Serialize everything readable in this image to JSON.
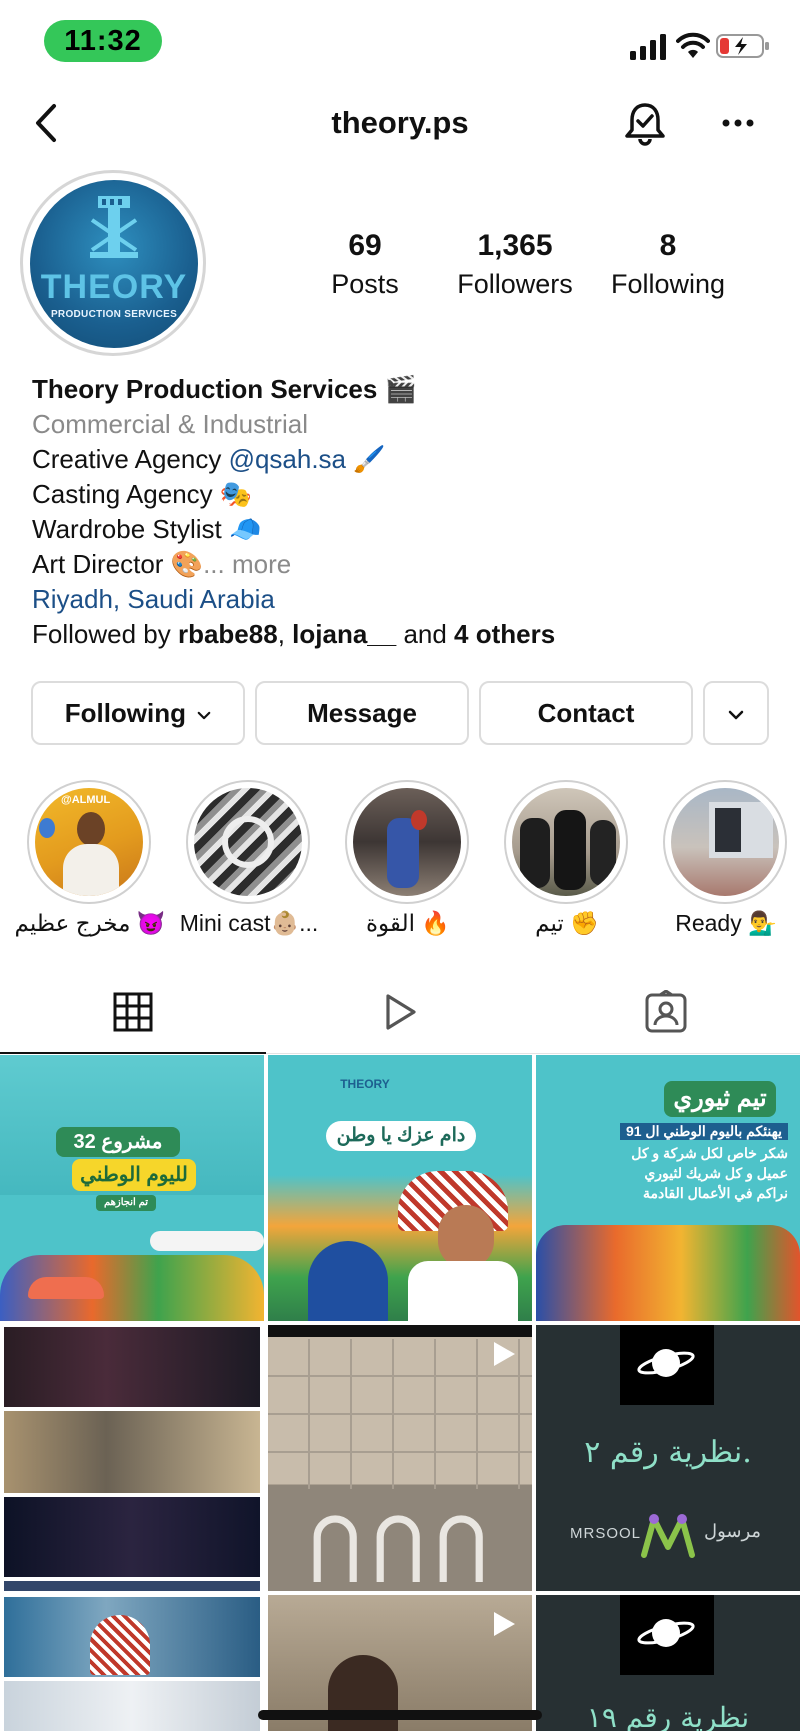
{
  "status_bar": {
    "time": "11:32"
  },
  "nav": {
    "username": "theory.ps"
  },
  "profile": {
    "avatar_logo": "THEORY",
    "avatar_sub": "PRODUCTION SERVICES",
    "stats": [
      {
        "value": "69",
        "label": "Posts"
      },
      {
        "value": "1,365",
        "label": "Followers"
      },
      {
        "value": "8",
        "label": "Following"
      }
    ],
    "bio": {
      "name": "Theory Production Services 🎬",
      "category": "Commercial & Industrial",
      "line1_text": "Creative Agency ",
      "line1_mention": "@qsah.sa",
      "line1_emoji": " 🖌️",
      "line2": "Casting Agency 🎭",
      "line3": "Wardrobe Stylist 🧢",
      "line4_text": "Art Director 🎨",
      "line4_more": "... more",
      "location": "Riyadh, Saudi Arabia",
      "followed_prefix": "Followed by ",
      "followed_user1": "rbabe88",
      "followed_sep": ", ",
      "followed_user2": "lojana__",
      "followed_and": " and ",
      "followed_others": "4 others"
    }
  },
  "actions": {
    "following_label": "Following",
    "message_label": "Message",
    "contact_label": "Contact"
  },
  "highlights": [
    {
      "label": "مخرج عظيم 😈",
      "avatar_text": "@ALMUL"
    },
    {
      "label": "Mini cast👶🏼..."
    },
    {
      "label": "القوة 🔥"
    },
    {
      "label": "تيم ✊"
    },
    {
      "label": "Ready 💁‍♂️"
    }
  ],
  "posts": {
    "post1": {
      "line1": "32 مشروع",
      "line2": "لليوم الوطني",
      "line3": "تم انجازهم"
    },
    "post2": {
      "logo": "THEORY",
      "banner": "دام عزك يا وطن"
    },
    "post3": {
      "title": "تيم ثيوري",
      "line1": "يهنئكم باليوم الوطني ال 91",
      "line2": "شكر خاص لكل شركة و كل",
      "line3": "عميل و كل شريك لثيوري",
      "line4": "نراكم في الأعمال القادمة"
    },
    "post6": {
      "headline": "نظرية رقم ٢.",
      "brand_en": "MRSOOL",
      "brand_ar": "مرسول"
    },
    "post9": {
      "headline": "نظرية رقم ١٩"
    }
  },
  "colors": {
    "accent_green": "#34c759",
    "link_blue": "#1c4f87",
    "teal": "#4ec3c9",
    "chalkboard": "#273033"
  }
}
